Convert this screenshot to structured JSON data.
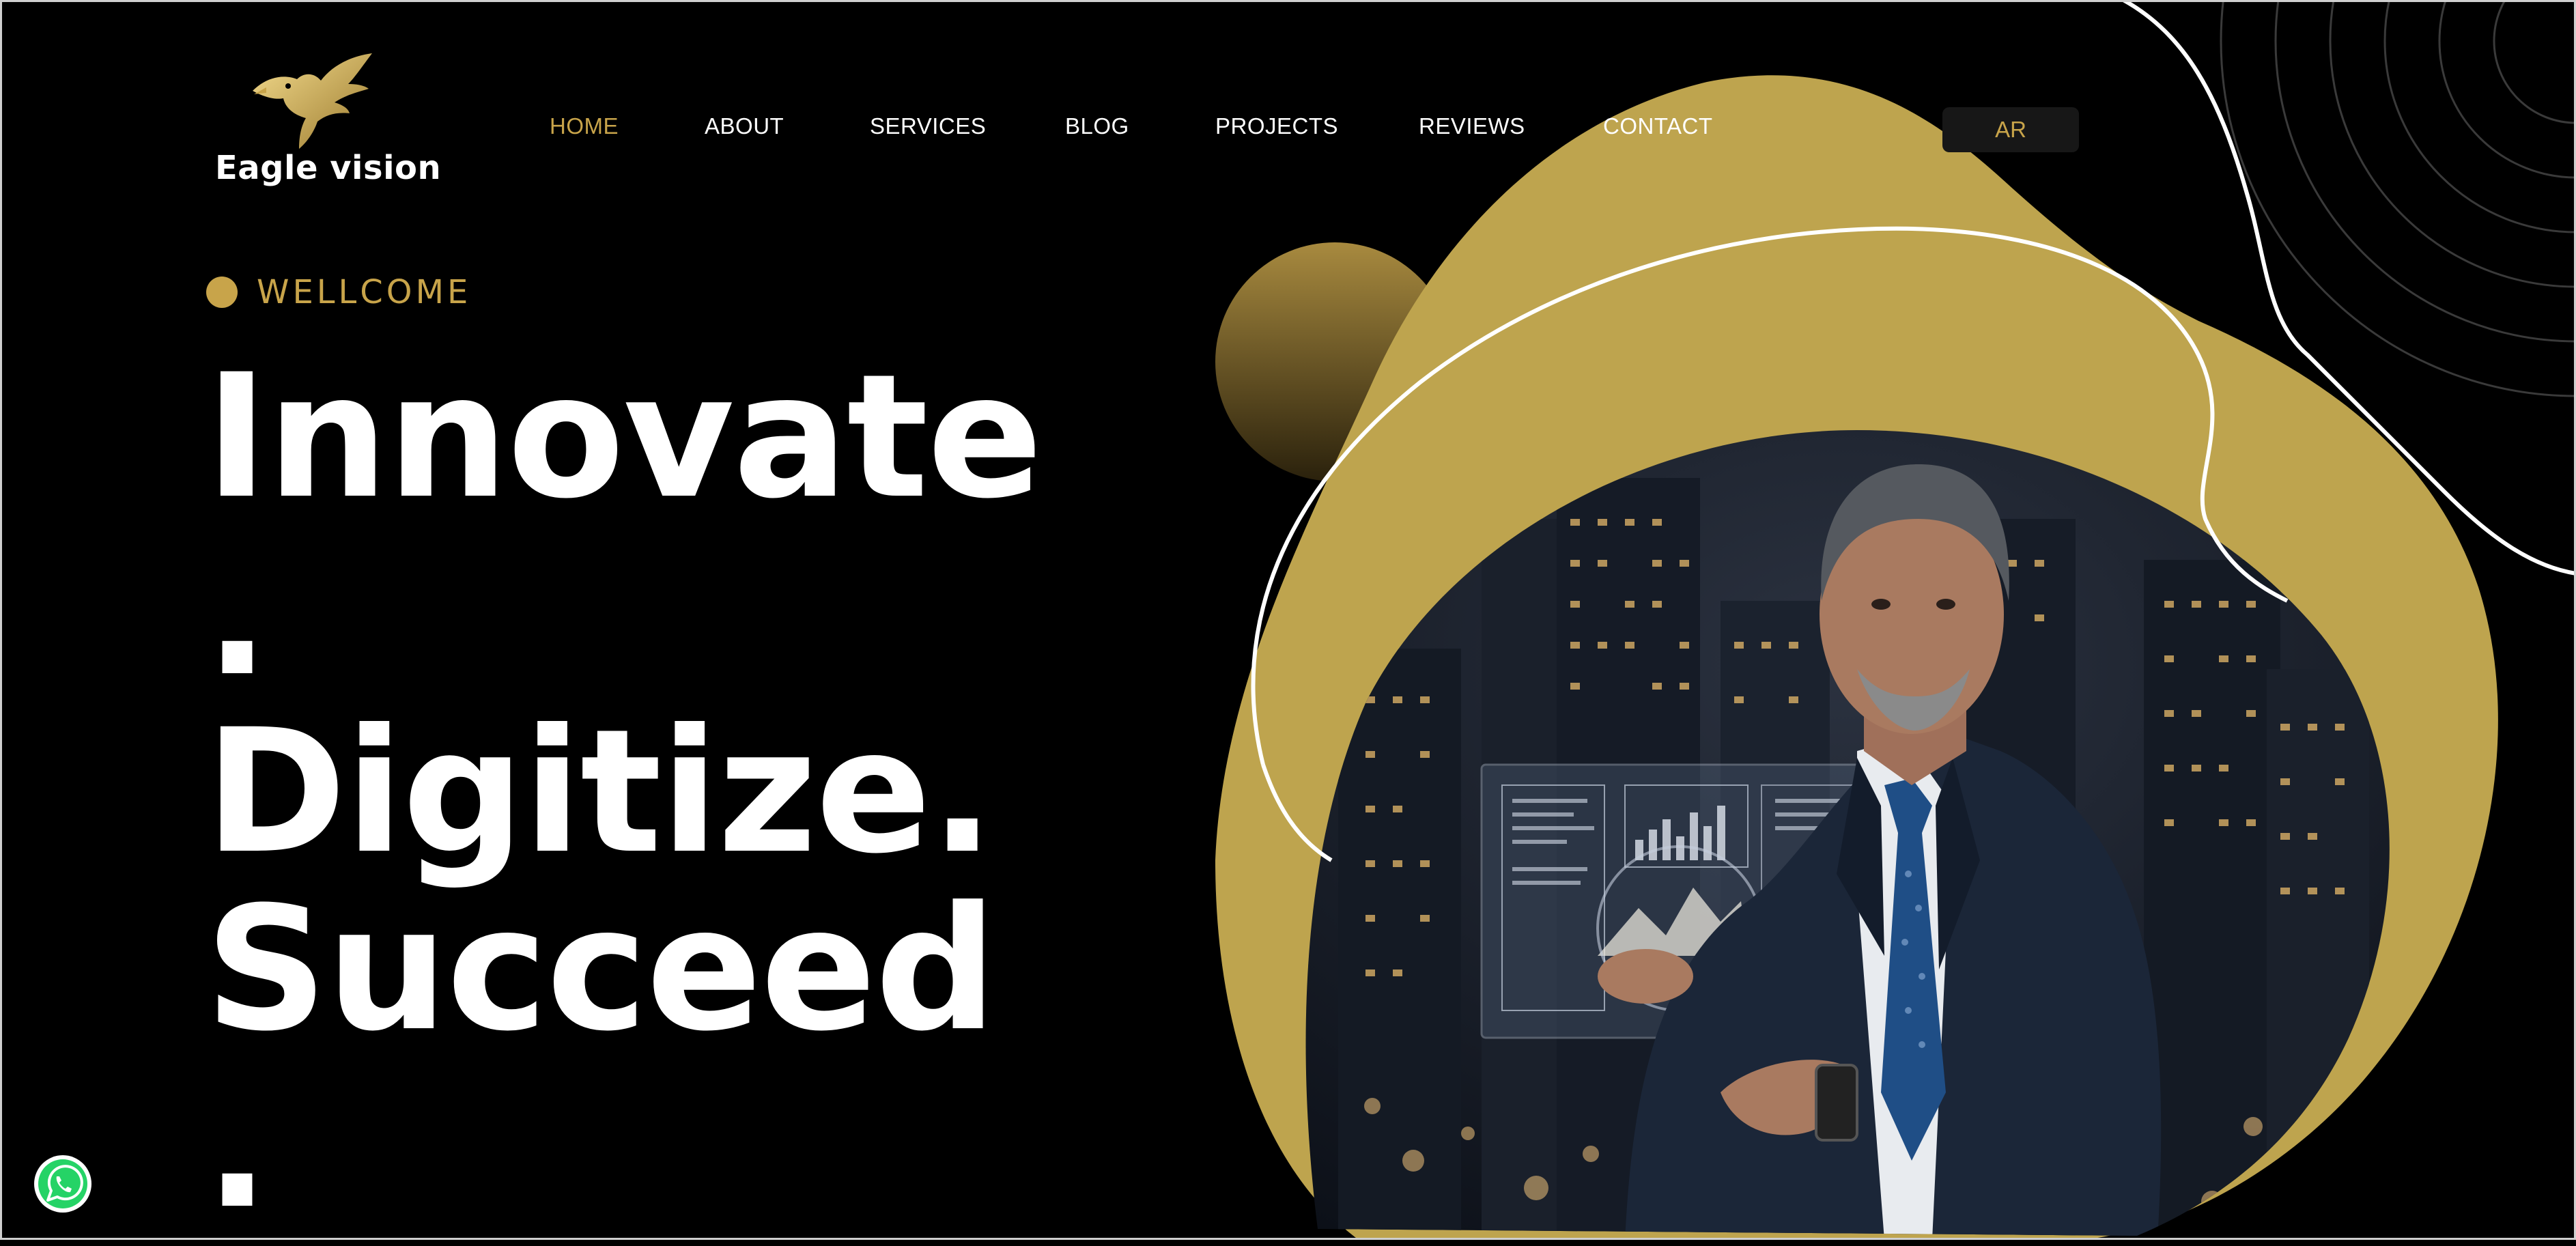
{
  "brand": {
    "name": "Eagle vision",
    "logo_icon": "eagle-icon"
  },
  "nav": {
    "items": [
      {
        "label": "HOME",
        "active": true
      },
      {
        "label": "ABOUT",
        "active": false
      },
      {
        "label": "SERVICES",
        "active": false
      },
      {
        "label": "BLOG",
        "active": false
      },
      {
        "label": "PROJECTS",
        "active": false
      },
      {
        "label": "REVIEWS",
        "active": false
      },
      {
        "label": "CONTACT",
        "active": false
      }
    ],
    "language_button": "AR"
  },
  "hero": {
    "welcome": "WELLCOME",
    "headline_lines": [
      "Innovate",
      ".",
      "Digitize.",
      "Succeed",
      "."
    ],
    "image_subject": "businessman-with-holographic-dashboard"
  },
  "floating": {
    "whatsapp_icon": "whatsapp-icon"
  },
  "colors": {
    "background": "#000000",
    "accent": "#c8a44a",
    "text": "#ffffff",
    "blob": "#bea44e"
  }
}
